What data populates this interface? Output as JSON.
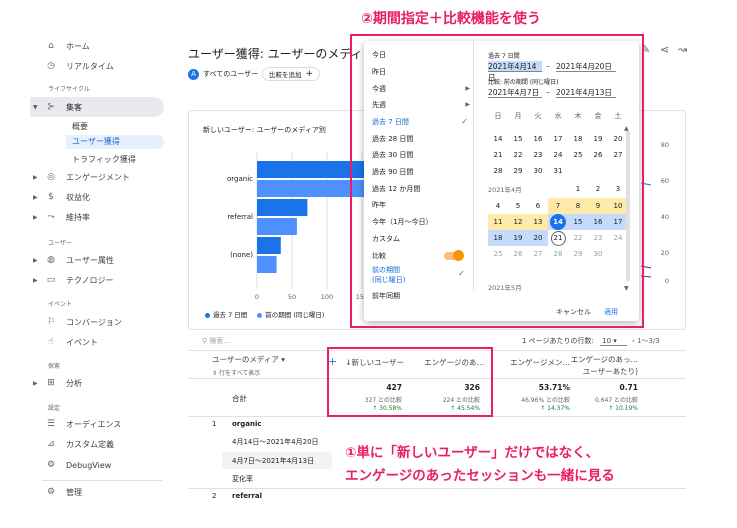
{
  "sidebar": {
    "home": "ホーム",
    "realtime": "リアルタイム",
    "section_lifecycle": "ライフサイクル",
    "acquisition": "集客",
    "acq_overview": "概要",
    "acq_user": "ユーザー獲得",
    "acq_traffic": "トラフィック獲得",
    "engagement": "エンゲージメント",
    "monetization": "収益化",
    "retention": "維持率",
    "section_user": "ユーザー",
    "user_attr": "ユーザー属性",
    "tech": "テクノロジー",
    "section_event": "イベント",
    "conversion": "コンバージョン",
    "events": "イベント",
    "section_explore": "探索",
    "analysis": "分析",
    "section_settings": "設定",
    "audience": "オーディエンス",
    "custom_def": "カスタム定義",
    "debugview": "DebugView",
    "admin": "管理"
  },
  "header": {
    "title": "ユーザー獲得: ユーザーのメディア",
    "all_users": "すべてのユーザー",
    "add_compare": "比較を追加"
  },
  "chart": {
    "title": "新しいユーザー: ユーザーのメディア別",
    "legend_current": "過去 7 日間",
    "legend_previous": "前の期間 (同じ曜日)"
  },
  "chart_data": {
    "type": "bar",
    "title": "新しいユーザー: ユーザーのメディア別",
    "categories": [
      "organic",
      "referral",
      "(none)"
    ],
    "series": [
      {
        "name": "過去 7 日間",
        "color": "#1a73e8",
        "values": [
          327,
          72,
          34
        ]
      },
      {
        "name": "前の期間 (同じ曜日)",
        "color": "#4d90fe",
        "values": [
          274,
          57,
          28
        ]
      }
    ],
    "x_ticks": [
      "0",
      "50",
      "100",
      "150"
    ],
    "y2_ticks": [
      "80",
      "60",
      "40",
      "20",
      "0"
    ],
    "legend": "bottom-left"
  },
  "table": {
    "search_placeholder": "検索...",
    "rows_per_page_label": "1 ページあたりの行数:",
    "rows_per_page": "10",
    "pager": "1〜3/3",
    "dim_header": "ユーザーのメディア",
    "dim_sub": "行をすべて表示",
    "col_new_users": "↓新しいユーザー",
    "col_engaged": "エンゲージのあ…",
    "col_eng_rate": "エンゲージメン…",
    "col_eng_per_user": "エンゲージのあっ…",
    "col_eng_per_user2": "ユーザーあたり)",
    "total_label": "合計",
    "totals": [
      {
        "value": "427",
        "sub": "327 との比較",
        "growth": "↑ 30.58%"
      },
      {
        "value": "326",
        "sub": "224 との比較",
        "growth": "↑ 45.54%"
      },
      {
        "value": "53.71%",
        "sub": "46.96% との比較",
        "growth": "↑ 14.37%"
      },
      {
        "value": "0.71",
        "sub": "0.647 との比較",
        "growth": "↑ 10.19%"
      }
    ],
    "row1_num": "1",
    "row1_label": "organic",
    "row1_range1": "4月14日〜2021年4月20日",
    "row1_range2": "4月7日〜2021年4月13日",
    "row1_change": "変化率",
    "row2_num": "2",
    "row2_label": "referral"
  },
  "picker": {
    "presets": {
      "today": "今日",
      "yesterday": "昨日",
      "this_week": "今週",
      "last_week": "先週",
      "last7": "過去 7 日間",
      "last28": "過去 28 日間",
      "last30": "過去 30 日間",
      "last90": "過去 90 日間",
      "last12m": "過去 12 か月間",
      "last_year": "昨年",
      "this_year": "今年（1月〜今日）",
      "custom": "カスタム",
      "compare": "比較",
      "prev_period": "前の期間",
      "prev_period2": "(同じ曜日)",
      "prev_year": "前年同期"
    },
    "range_label": "過去 7 日間",
    "range_start": "2021年4月14日",
    "range_end": "2021年4月20日",
    "compare_label": "比較: 前の期間 (同じ曜日)",
    "compare_start": "2021年4月7日",
    "compare_end": "2021年4月13日",
    "dows": [
      "日",
      "月",
      "火",
      "水",
      "木",
      "金",
      "土"
    ],
    "march_row1": [
      "14",
      "15",
      "16",
      "17",
      "18",
      "19",
      "20"
    ],
    "march_row2": [
      "21",
      "22",
      "23",
      "24",
      "25",
      "26",
      "27"
    ],
    "march_row3": [
      "28",
      "29",
      "30",
      "31",
      "",
      "",
      ""
    ],
    "month_april": "2021年4月",
    "april_row1": [
      "",
      "",
      "",
      "",
      "1",
      "2",
      "3"
    ],
    "april_row2": [
      "4",
      "5",
      "6",
      "7",
      "8",
      "9",
      "10"
    ],
    "april_row3": [
      "11",
      "12",
      "13",
      "14",
      "15",
      "16",
      "17"
    ],
    "april_row4": [
      "18",
      "19",
      "20",
      "21",
      "22",
      "23",
      "24"
    ],
    "april_row5": [
      "25",
      "26",
      "27",
      "28",
      "29",
      "30",
      ""
    ],
    "month_may": "2021年5月",
    "cancel": "キャンセル",
    "apply": "適用"
  },
  "annotations": {
    "callout_top": "②期間指定＋比較機能を使う",
    "callout_bottom_1": "①単に「新しいユーザー」だけではなく、",
    "callout_bottom_2": "エンゲージのあったセッションも一緒に見る",
    "highlight_color": "#e91e63"
  }
}
